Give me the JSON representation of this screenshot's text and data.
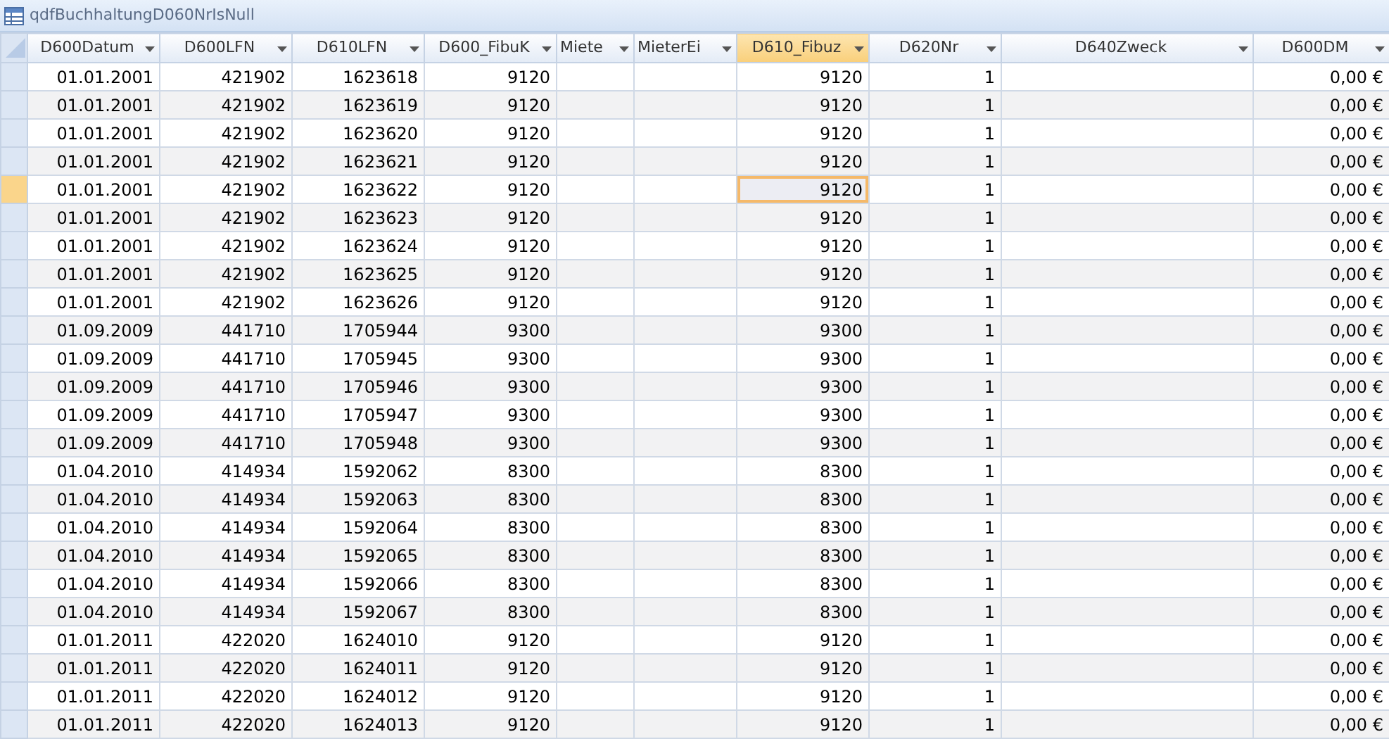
{
  "window": {
    "title": "qdfBuchhaltungD060NrIsNull"
  },
  "table": {
    "columns": [
      {
        "label": "D600Datum",
        "selected": false
      },
      {
        "label": "D600LFN",
        "selected": false
      },
      {
        "label": "D610LFN",
        "selected": false
      },
      {
        "label": "D600_FibuK",
        "selected": false
      },
      {
        "label": "Miete",
        "selected": false
      },
      {
        "label": "MieterEi",
        "selected": false
      },
      {
        "label": "D610_Fibuz",
        "selected": true
      },
      {
        "label": "D620Nr",
        "selected": false
      },
      {
        "label": "D640Zweck",
        "selected": false
      },
      {
        "label": "D600DM",
        "selected": false
      }
    ],
    "rows": [
      {
        "selected": false,
        "column_1": "01.01.2001",
        "column_2": "421902",
        "column_3": "1623618",
        "column_4": "9120",
        "column_7": "9120",
        "column_8": "1",
        "column_10": "0,00 €"
      },
      {
        "selected": false,
        "column_1": "01.01.2001",
        "column_2": "421902",
        "column_3": "1623619",
        "column_4": "9120",
        "column_7": "9120",
        "column_8": "1",
        "column_10": "0,00 €"
      },
      {
        "selected": false,
        "column_1": "01.01.2001",
        "column_2": "421902",
        "column_3": "1623620",
        "column_4": "9120",
        "column_7": "9120",
        "column_8": "1",
        "column_10": "0,00 €"
      },
      {
        "selected": false,
        "column_1": "01.01.2001",
        "column_2": "421902",
        "column_3": "1623621",
        "column_4": "9120",
        "column_7": "9120",
        "column_8": "1",
        "column_10": "0,00 €"
      },
      {
        "selected": true,
        "column_1": "01.01.2001",
        "column_2": "421902",
        "column_3": "1623622",
        "column_4": "9120",
        "column_7": "9120",
        "column_8": "1",
        "column_10": "0,00 €"
      },
      {
        "selected": false,
        "column_1": "01.01.2001",
        "column_2": "421902",
        "column_3": "1623623",
        "column_4": "9120",
        "column_7": "9120",
        "column_8": "1",
        "column_10": "0,00 €"
      },
      {
        "selected": false,
        "column_1": "01.01.2001",
        "column_2": "421902",
        "column_3": "1623624",
        "column_4": "9120",
        "column_7": "9120",
        "column_8": "1",
        "column_10": "0,00 €"
      },
      {
        "selected": false,
        "column_1": "01.01.2001",
        "column_2": "421902",
        "column_3": "1623625",
        "column_4": "9120",
        "column_7": "9120",
        "column_8": "1",
        "column_10": "0,00 €"
      },
      {
        "selected": false,
        "column_1": "01.01.2001",
        "column_2": "421902",
        "column_3": "1623626",
        "column_4": "9120",
        "column_7": "9120",
        "column_8": "1",
        "column_10": "0,00 €"
      },
      {
        "selected": false,
        "column_1": "01.09.2009",
        "column_2": "441710",
        "column_3": "1705944",
        "column_4": "9300",
        "column_7": "9300",
        "column_8": "1",
        "column_10": "0,00 €"
      },
      {
        "selected": false,
        "column_1": "01.09.2009",
        "column_2": "441710",
        "column_3": "1705945",
        "column_4": "9300",
        "column_7": "9300",
        "column_8": "1",
        "column_10": "0,00 €"
      },
      {
        "selected": false,
        "column_1": "01.09.2009",
        "column_2": "441710",
        "column_3": "1705946",
        "column_4": "9300",
        "column_7": "9300",
        "column_8": "1",
        "column_10": "0,00 €"
      },
      {
        "selected": false,
        "column_1": "01.09.2009",
        "column_2": "441710",
        "column_3": "1705947",
        "column_4": "9300",
        "column_7": "9300",
        "column_8": "1",
        "column_10": "0,00 €"
      },
      {
        "selected": false,
        "column_1": "01.09.2009",
        "column_2": "441710",
        "column_3": "1705948",
        "column_4": "9300",
        "column_7": "9300",
        "column_8": "1",
        "column_10": "0,00 €"
      },
      {
        "selected": false,
        "column_1": "01.04.2010",
        "column_2": "414934",
        "column_3": "1592062",
        "column_4": "8300",
        "column_7": "8300",
        "column_8": "1",
        "column_10": "0,00 €"
      },
      {
        "selected": false,
        "column_1": "01.04.2010",
        "column_2": "414934",
        "column_3": "1592063",
        "column_4": "8300",
        "column_7": "8300",
        "column_8": "1",
        "column_10": "0,00 €"
      },
      {
        "selected": false,
        "column_1": "01.04.2010",
        "column_2": "414934",
        "column_3": "1592064",
        "column_4": "8300",
        "column_7": "8300",
        "column_8": "1",
        "column_10": "0,00 €"
      },
      {
        "selected": false,
        "column_1": "01.04.2010",
        "column_2": "414934",
        "column_3": "1592065",
        "column_4": "8300",
        "column_7": "8300",
        "column_8": "1",
        "column_10": "0,00 €"
      },
      {
        "selected": false,
        "column_1": "01.04.2010",
        "column_2": "414934",
        "column_3": "1592066",
        "column_4": "8300",
        "column_7": "8300",
        "column_8": "1",
        "column_10": "0,00 €"
      },
      {
        "selected": false,
        "column_1": "01.04.2010",
        "column_2": "414934",
        "column_3": "1592067",
        "column_4": "8300",
        "column_7": "8300",
        "column_8": "1",
        "column_10": "0,00 €"
      },
      {
        "selected": false,
        "column_1": "01.01.2011",
        "column_2": "422020",
        "column_3": "1624010",
        "column_4": "9120",
        "column_7": "9120",
        "column_8": "1",
        "column_10": "0,00 €"
      },
      {
        "selected": false,
        "column_1": "01.01.2011",
        "column_2": "422020",
        "column_3": "1624011",
        "column_4": "9120",
        "column_7": "9120",
        "column_8": "1",
        "column_10": "0,00 €"
      },
      {
        "selected": false,
        "column_1": "01.01.2011",
        "column_2": "422020",
        "column_3": "1624012",
        "column_4": "9120",
        "column_7": "9120",
        "column_8": "1",
        "column_10": "0,00 €"
      },
      {
        "selected": false,
        "column_1": "01.01.2011",
        "column_2": "422020",
        "column_3": "1624013",
        "column_4": "9120",
        "column_7": "9120",
        "column_8": "1",
        "column_10": "0,00 €"
      }
    ]
  }
}
